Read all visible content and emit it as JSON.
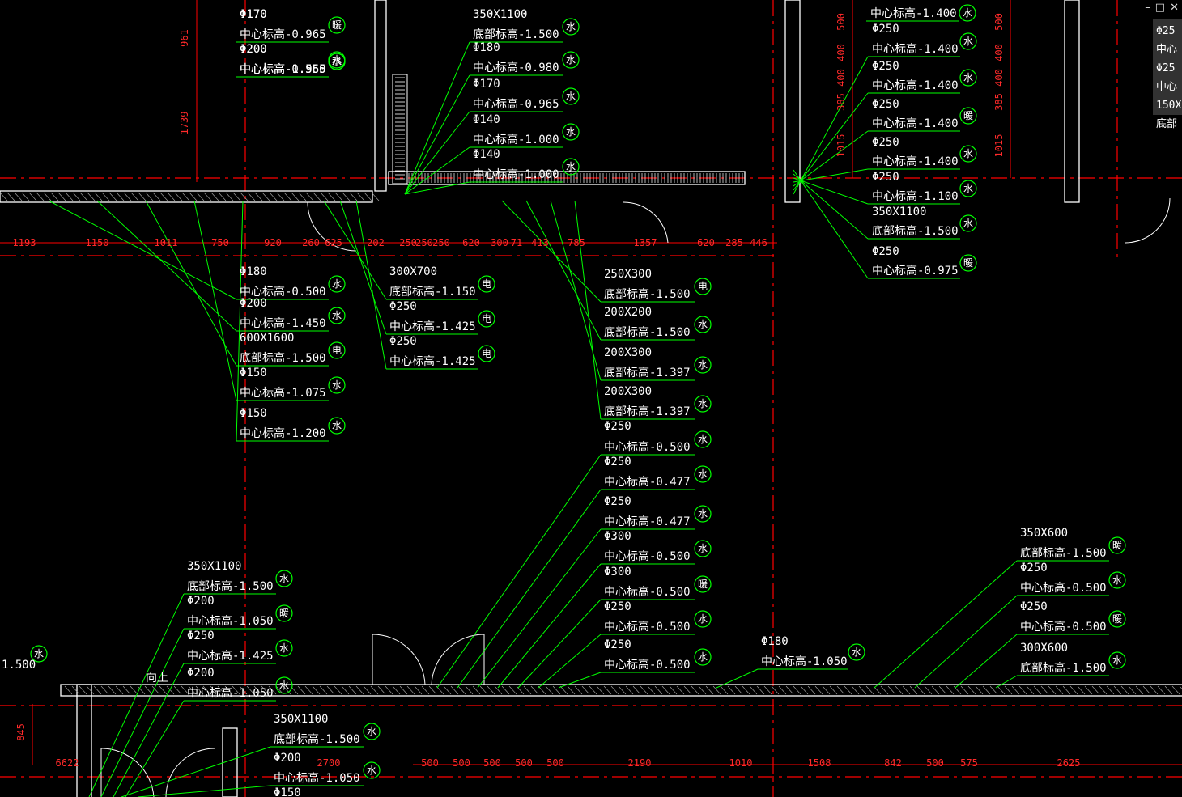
{
  "window_controls": {
    "minimize": "–",
    "restore": "□",
    "close": "✕"
  },
  "colors": {
    "background": "#000000",
    "leader": "#00ff00",
    "grid": "#ff0000",
    "wall": "#ffffff",
    "text": "#ffffff",
    "hatch": "#aaaaaa"
  },
  "labels": [
    "Φ170",
    "中心标高-0.965",
    "Φ200",
    "中心标高-1.550",
    "350X1100",
    "底部标高-1.500",
    "Φ180",
    "中心标高-0.980",
    "Φ170",
    "中心标高-0.965",
    "Φ140",
    "中心标高-1.000",
    "Φ140",
    "中心标高-1.000",
    "中心标高-1.400",
    "Φ250",
    "中心标高-1.400",
    "Φ250",
    "中心标高-1.400",
    "Φ250",
    "中心标高-1.400",
    "Φ250",
    "中心标高-1.400",
    "Φ250",
    "中心标高-1.100",
    "350X1100",
    "底部标高-1.500",
    "Φ250",
    "中心标高-0.975",
    "Φ180",
    "中心标高-0.500",
    "Φ200",
    "中心标高-1.450",
    "600X1600",
    "底部标高-1.500",
    "Φ150",
    "中心标高-1.075",
    "Φ150",
    "中心标高-1.200",
    "300X700",
    "底部标高-1.150",
    "Φ250",
    "中心标高-1.425",
    "Φ250",
    "中心标高-1.425",
    "250X300",
    "底部标高-1.500",
    "200X200",
    "底部标高-1.500",
    "200X300",
    "底部标高-1.397",
    "200X300",
    "底部标高-1.397",
    "Φ250",
    "中心标高-0.500",
    "Φ250",
    "中心标高-0.477",
    "Φ250",
    "中心标高-0.477",
    "Φ300",
    "中心标高-0.500",
    "Φ300",
    "中心标高-0.500",
    "Φ250",
    "中心标高-0.500",
    "Φ250",
    "中心标高-0.500",
    "350X600",
    "底部标高-1.500",
    "Φ250",
    "中心标高-0.500",
    "Φ250",
    "中心标高-0.500",
    "300X600",
    "底部标高-1.500",
    "Φ180",
    "中心标高-1.050",
    "350X1100",
    "底部标高-1.500",
    "Φ200",
    "中心标高-1.050",
    "Φ250",
    "中心标高-1.425",
    "Φ200",
    "中心标高-1.050",
    "350X1100",
    "底部标高-1.500",
    "Φ200",
    "中心标高-1.050",
    "Φ150",
    "1.500",
    "向上"
  ],
  "tags": [
    "水",
    "水",
    "暖",
    "水",
    "水",
    "水",
    "水",
    "水",
    "水",
    "水",
    "水",
    "水",
    "暖",
    "水",
    "水",
    "水",
    "暖",
    "水",
    "水",
    "电",
    "水",
    "水",
    "电",
    "电",
    "电",
    "电",
    "水",
    "水",
    "水",
    "水",
    "水",
    "水",
    "水",
    "暖",
    "水",
    "水",
    "暖",
    "水",
    "暖",
    "水",
    "水",
    "水",
    "暖",
    "水",
    "水",
    "水",
    "水",
    "水",
    "暖"
  ],
  "dims": [
    "1193",
    "1150",
    "1011",
    "750",
    "920",
    "260",
    "625",
    "202",
    "250",
    "250",
    "250",
    "620",
    "300",
    "71",
    "413",
    "785",
    "1357",
    "620",
    "285",
    "446",
    "961",
    "1739",
    "500",
    "400",
    "400",
    "385",
    "1015",
    "500",
    "400",
    "400",
    "385",
    "1015",
    "845",
    "6622",
    "2700",
    "500",
    "500",
    "500",
    "500",
    "500",
    "2190",
    "1010",
    "1508",
    "842",
    "500",
    "575",
    "2625"
  ],
  "side_panel": [
    "Φ25",
    "中心",
    "Φ25",
    "中心",
    "150X",
    "底部"
  ]
}
